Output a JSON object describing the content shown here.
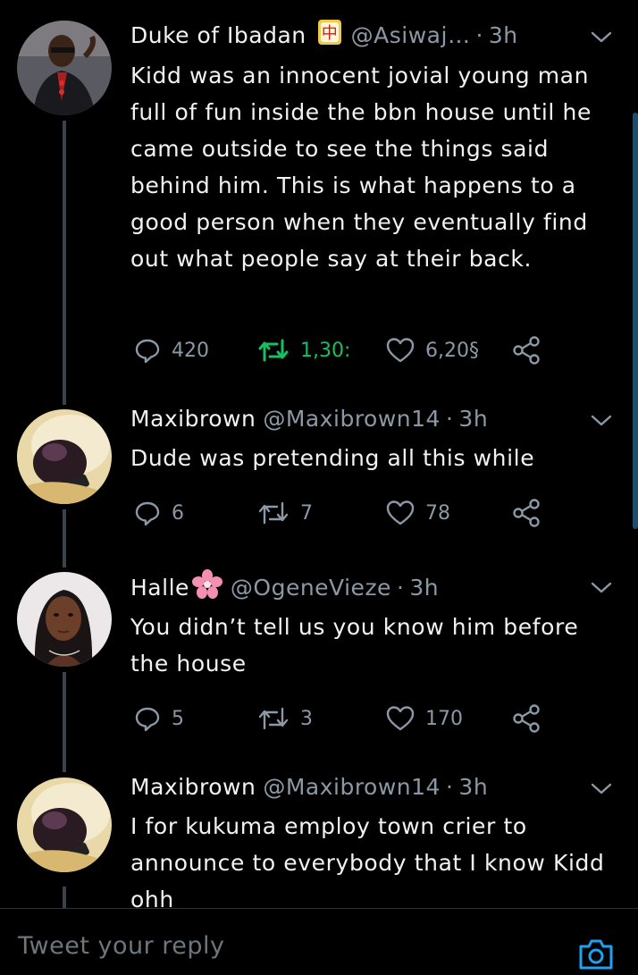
{
  "tweets": [
    {
      "name": "Duke of Ibadan",
      "handle": "@Asiwaj…",
      "time": "3h",
      "text": "Kidd was an innocent jovial young man full of fun inside the bbn house until he came outside to see the things said behind him. This is what happens to a good person when they eventually find out what people say at their back.",
      "replies": "420",
      "retweets": "1,30:",
      "likes": "6,20§"
    },
    {
      "name": "Maxibrown",
      "handle": "@Maxibrown14",
      "time": "3h",
      "text": "Dude was pretending all this while",
      "replies": "6",
      "retweets": "7",
      "likes": "78"
    },
    {
      "name": "Halle",
      "handle": "@OgeneVieze",
      "time": "3h",
      "text": "You didn’t tell us you know him before the house",
      "replies": "5",
      "retweets": "3",
      "likes": "170"
    },
    {
      "name": "Maxibrown",
      "handle": "@Maxibrown14",
      "time": "3h",
      "text": "I for kukuma employ town crier to announce to everybody that I know Kidd ohh"
    }
  ],
  "reply_bar": {
    "placeholder": "Tweet your reply"
  },
  "icons": {
    "verified_emoji": "mahjong-tile-icon",
    "name_emoji": "cherry-blossom-icon",
    "reply": "reply-icon",
    "retweet": "retweet-icon",
    "like": "heart-icon",
    "share": "share-icon",
    "more": "chevron-down-icon",
    "camera": "camera-icon"
  },
  "colors": {
    "background": "#000000",
    "text": "#f2f2f2",
    "muted": "#8b98a5",
    "retweet_active": "#17bf63",
    "accent": "#1da1f2"
  }
}
